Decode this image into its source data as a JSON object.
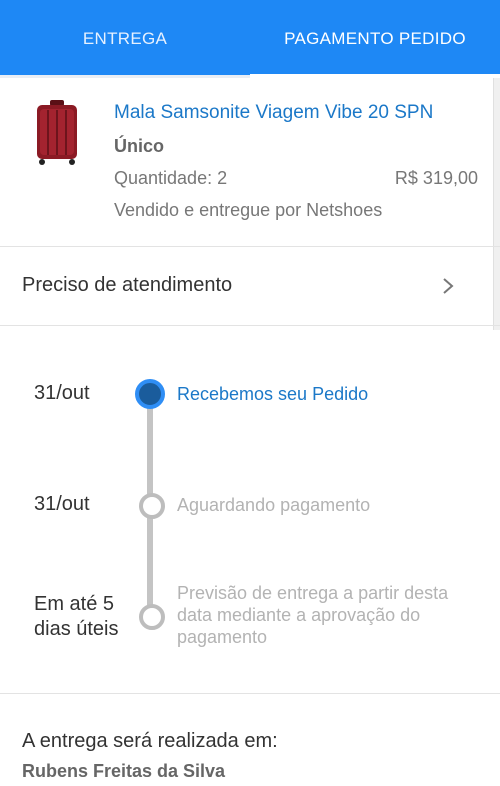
{
  "tabs": [
    {
      "label": "ENTREGA"
    },
    {
      "label": "PAGAMENTO PEDIDO"
    }
  ],
  "product": {
    "name": "Mala Samsonite Viagem Vibe 20 SPN",
    "variant": "Único",
    "quantity": "Quantidade: 2",
    "price": "R$ 319,00",
    "seller": "Vendido e entregue por Netshoes",
    "image_color": "#8b1a24"
  },
  "support": {
    "label": "Preciso de atendimento",
    "icon": "chevron-right-icon"
  },
  "timeline": [
    {
      "date": "31/out",
      "status": "Recebemos seu Pedido",
      "active": true
    },
    {
      "date": "31/out",
      "status": "Aguardando pagamento",
      "active": false
    },
    {
      "date": "Em até 5\ndias úteis",
      "status": "Previsão de entrega a partir desta data mediante a aprovação do pagamento",
      "active": false
    }
  ],
  "delivery": {
    "label": "A entrega será realizada em:",
    "recipient": "Rubens Freitas da Silva"
  },
  "colors": {
    "header": "#1e88f5",
    "accent": "#1b78c8",
    "active_node": "#1a5c9c"
  }
}
